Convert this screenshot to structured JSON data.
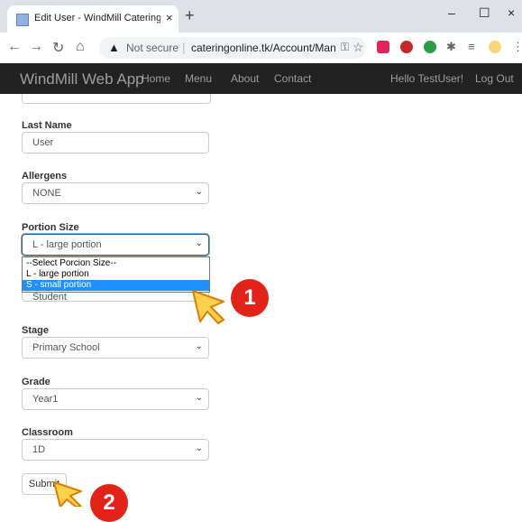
{
  "browser": {
    "tab_title": "Edit User - WindMill Catering We",
    "new_tab": "+",
    "minimize": "–",
    "maximize": "☐",
    "close": "×",
    "security_label": "Not secure",
    "url": "cateringonline.tk/Account/Man..."
  },
  "navbar": {
    "brand": "WindMill Web App",
    "links": [
      "Home",
      "Menu",
      "About",
      "Contact"
    ],
    "greeting": "Hello TestUser!",
    "logout": "Log Out"
  },
  "form": {
    "last_name_label": "Last Name",
    "last_name_value": "User",
    "allergens_label": "Allergens",
    "allergens_value": "NONE",
    "portion_label": "Portion Size",
    "portion_value": "L - large portion",
    "portion_options": [
      "--Select Porcion Size--",
      "L - large portion",
      "S - small portion"
    ],
    "role_value": "Student",
    "stage_label": "Stage",
    "stage_value": "Primary School",
    "grade_label": "Grade",
    "grade_value": "Year1",
    "classroom_label": "Classroom",
    "classroom_value": "1D",
    "submit_label": "Submit"
  },
  "annotations": {
    "step1": "1",
    "step2": "2"
  },
  "colors": {
    "navbar_bg": "#222222",
    "selected_option": "#1e90ff",
    "badge": "#e2231a",
    "cursor": "#ffd24d"
  }
}
